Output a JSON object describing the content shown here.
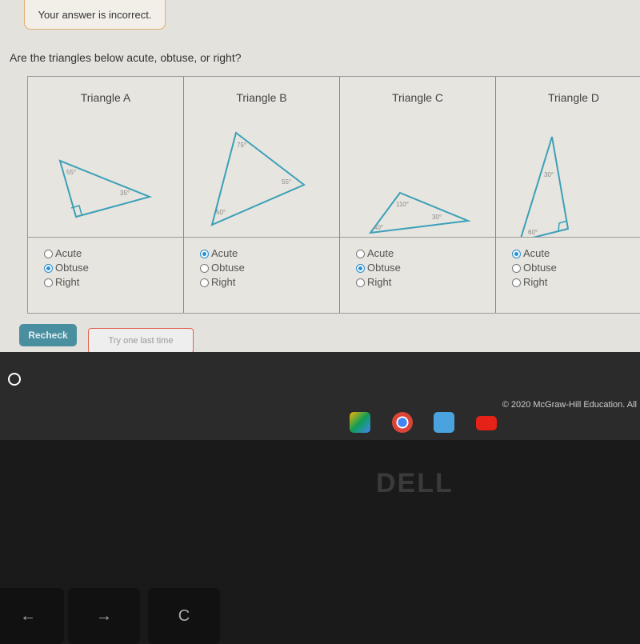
{
  "feedback": "Your answer is incorrect.",
  "question": "Are the triangles below acute, obtuse, or right?",
  "accent": "#2a8fd0",
  "triangle_color": "#3aa0b8",
  "options": [
    "Acute",
    "Obtuse",
    "Right"
  ],
  "triangles": [
    {
      "title": "Triangle A",
      "angles": [
        "55°",
        "35°"
      ],
      "right_angle": true,
      "selected": "Obtuse"
    },
    {
      "title": "Triangle B",
      "angles": [
        "75°",
        "55°",
        "50°"
      ],
      "right_angle": false,
      "selected": "Acute"
    },
    {
      "title": "Triangle C",
      "angles": [
        "110°",
        "30°",
        "40°"
      ],
      "right_angle": false,
      "selected": "Obtuse"
    },
    {
      "title": "Triangle D",
      "angles": [
        "30°",
        "60°"
      ],
      "right_angle": true,
      "selected": "Acute"
    }
  ],
  "recheck_label": "Recheck",
  "hint": "Try one last time",
  "copyright": "© 2020 McGraw-Hill Education. All",
  "shelf_apps": [
    "drive-icon",
    "chrome-icon",
    "keep-icon",
    "youtube-icon"
  ],
  "brand": "DELL",
  "keys": [
    "←",
    "→",
    "C"
  ]
}
